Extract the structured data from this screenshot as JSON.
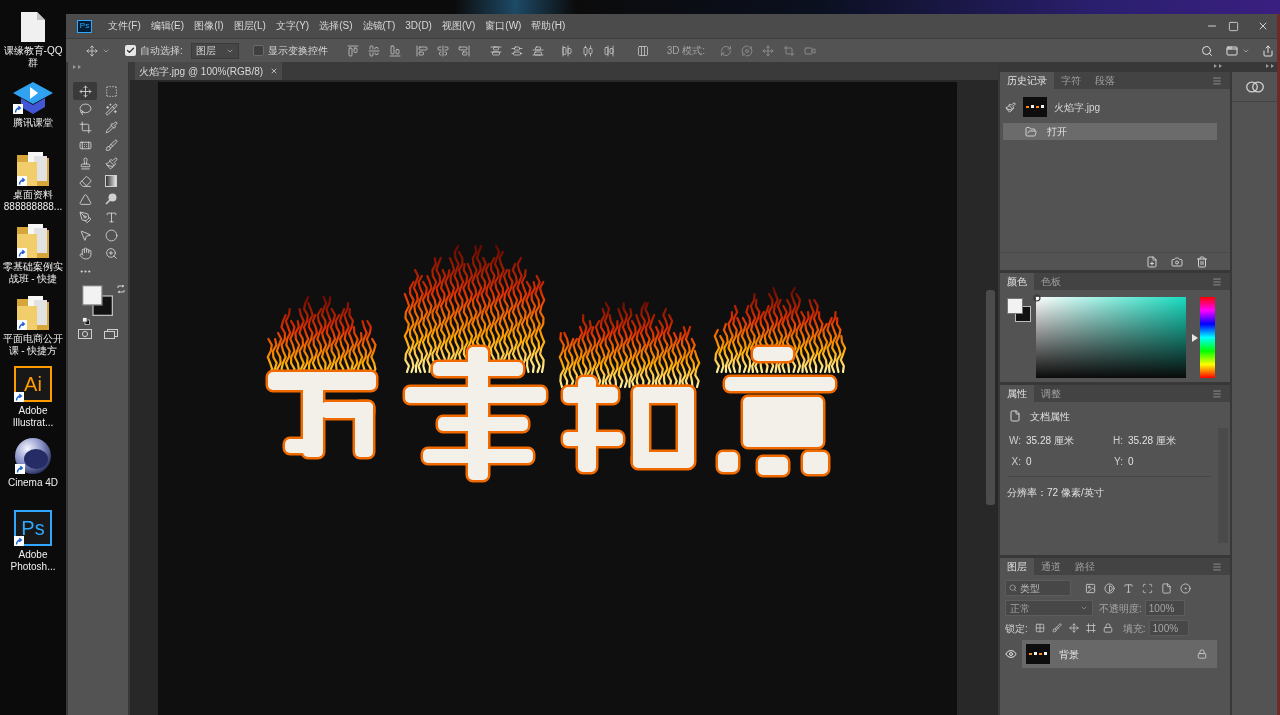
{
  "desktop": {
    "icons": [
      {
        "kind": "file",
        "label": "课缘教育-QQ群",
        "shortcut": false
      },
      {
        "kind": "classroom",
        "label": "腾讯课堂",
        "shortcut": true
      },
      {
        "kind": "folder",
        "label": "桌面资料888888888...",
        "shortcut": true
      },
      {
        "kind": "folder",
        "label": "零基础案例实战班 - 快捷",
        "shortcut": true
      },
      {
        "kind": "folder",
        "label": "平面电商公开课 - 快捷方",
        "shortcut": true
      },
      {
        "kind": "adobe",
        "logo": "Ai",
        "color": "#ff9a00",
        "label": "Adobe Illustrat...",
        "shortcut": true
      },
      {
        "kind": "sphere",
        "label": "Cinema 4D",
        "shortcut": true
      },
      {
        "kind": "adobe",
        "logo": "Ps",
        "color": "#31a8ff",
        "label": "Adobe Photosh...",
        "shortcut": true
      }
    ]
  },
  "window": {
    "logo": "Ps",
    "menu": [
      "文件(F)",
      "编辑(E)",
      "图像(I)",
      "图层(L)",
      "文字(Y)",
      "选择(S)",
      "滤镜(T)",
      "3D(D)",
      "视图(V)",
      "窗口(W)",
      "帮助(H)"
    ]
  },
  "options_bar": {
    "auto_select": {
      "label": "自动选择:",
      "checked": true
    },
    "auto_select_target": {
      "value": "图层"
    },
    "show_transform": {
      "label": "显示变换控件",
      "checked": false
    },
    "mode_3d": {
      "label": "3D 模式:",
      "disabled": true
    }
  },
  "document_tab": {
    "title": "火焰字.jpg @ 100%(RGB/8)"
  },
  "tools": [
    {
      "kind": "move",
      "selected": true
    },
    {
      "kind": "marquee",
      "selected": false
    },
    {
      "kind": "lasso",
      "selected": false
    },
    {
      "kind": "wand",
      "selected": false
    },
    {
      "kind": "crop",
      "selected": false
    },
    {
      "kind": "eyedropper",
      "selected": false
    },
    {
      "kind": "healing",
      "selected": false
    },
    {
      "kind": "brush",
      "selected": false
    },
    {
      "kind": "stamp",
      "selected": false
    },
    {
      "kind": "history-brush",
      "selected": false
    },
    {
      "kind": "eraser",
      "selected": false
    },
    {
      "kind": "gradient",
      "selected": false
    },
    {
      "kind": "blur",
      "selected": false
    },
    {
      "kind": "dodge",
      "selected": false
    },
    {
      "kind": "pen",
      "selected": false
    },
    {
      "kind": "type",
      "selected": false
    },
    {
      "kind": "path-select",
      "selected": false
    },
    {
      "kind": "ellipse",
      "selected": false
    },
    {
      "kind": "hand",
      "selected": false
    },
    {
      "kind": "zoom",
      "selected": false
    }
  ],
  "panels": {
    "history": {
      "tabs": [
        {
          "label": "历史记录",
          "selected": true
        },
        {
          "label": "字符",
          "selected": false
        },
        {
          "label": "段落",
          "selected": false
        }
      ],
      "snapshot": "火焰字.jpg",
      "states": [
        {
          "label": "打开",
          "selected": true
        }
      ]
    },
    "color": {
      "tabs": [
        {
          "label": "颜色",
          "selected": true
        },
        {
          "label": "色板",
          "selected": false
        }
      ],
      "hue_slider": {
        "level": 0.5
      }
    },
    "properties": {
      "tabs": [
        {
          "label": "属性",
          "selected": true
        },
        {
          "label": "调整",
          "selected": false
        }
      ],
      "heading": "文档属性",
      "fields": [
        {
          "label": "W:",
          "value": "35.28 厘米"
        },
        {
          "label": "H:",
          "value": "35.28 厘米"
        },
        {
          "label": "X:",
          "value": "0"
        },
        {
          "label": "Y:",
          "value": "0"
        }
      ],
      "resolution": "分辨率：72 像素/英寸"
    },
    "layers": {
      "tabs": [
        {
          "label": "图层",
          "selected": true
        },
        {
          "label": "通道",
          "selected": false
        },
        {
          "label": "路径",
          "selected": false
        }
      ],
      "filter_placeholder": "类型",
      "blend_mode": {
        "value": "正常",
        "disabled": true
      },
      "opacity": {
        "label": "不透明度:",
        "value": "100%",
        "disabled": true
      },
      "lock_label": "锁定:",
      "fill": {
        "label": "填充:",
        "value": "100%",
        "disabled": true
      },
      "items": [
        {
          "name": "背景",
          "visible": true,
          "locked": true,
          "selected": true
        }
      ]
    }
  }
}
